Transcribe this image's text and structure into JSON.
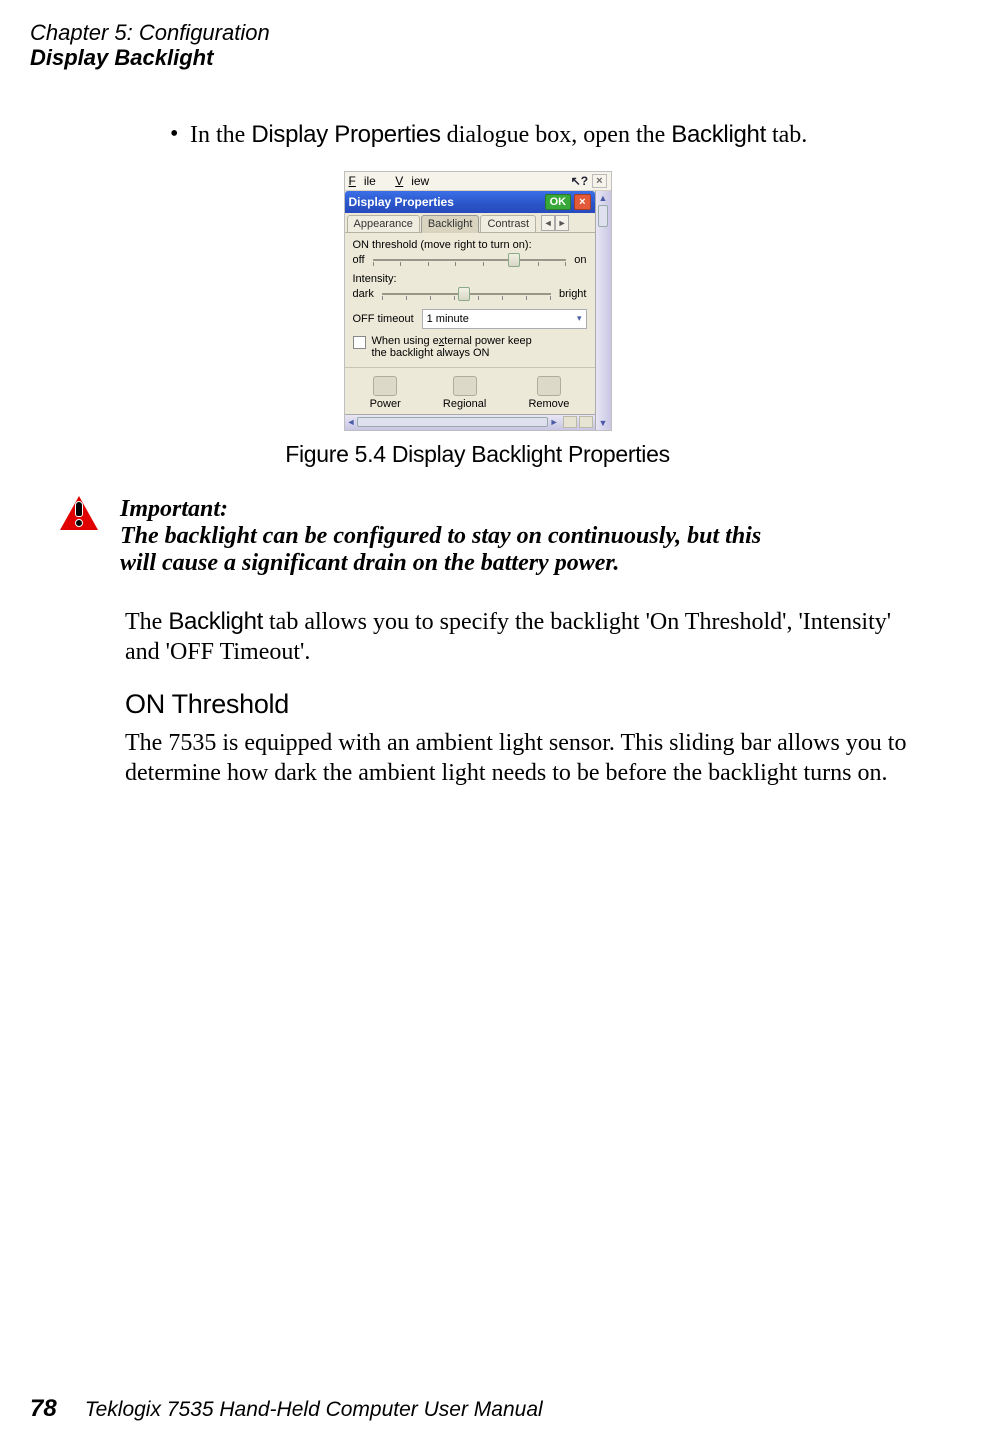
{
  "header": {
    "chapter": "Chapter 5: Configuration",
    "section": "Display Backlight"
  },
  "bullet": {
    "pre": "In the ",
    "term1": "Display Properties",
    "mid": " dialogue box, open the ",
    "term2": "Backlight",
    "post": " tab."
  },
  "figure": {
    "menubar": {
      "file": "File",
      "view": "View",
      "help": "?",
      "close": "×"
    },
    "titlebar": {
      "title": "Display Properties",
      "ok": "OK",
      "close": "×"
    },
    "tabs": {
      "appearance": "Appearance",
      "backlight": "Backlight",
      "contrast": "Contrast",
      "left": "◄",
      "right": "►"
    },
    "pane": {
      "on_label": "ON threshold (move right to turn on):",
      "off": "off",
      "on": "on",
      "intensity": "Intensity:",
      "dark": "dark",
      "bright": "bright",
      "offtimeout": "OFF timeout",
      "combo_value": "1 minute",
      "chk_line1": "When using external power keep",
      "chk_line2": "the backlight always ON"
    },
    "icons": {
      "power": "Power",
      "regional": "Regional",
      "remove": "Remove"
    },
    "hscroll": {
      "left": "◄",
      "right": "►"
    },
    "caption": "Figure 5.4 Display Backlight Properties"
  },
  "important": {
    "label": "Important:",
    "text": "The backlight can be configured to stay on continuously, but this will cause a significant drain on the battery power."
  },
  "para1": {
    "pre": "The ",
    "term": "Backlight",
    "post": " tab allows you to specify the backlight 'On Threshold', 'Intensity' and 'OFF Timeout'."
  },
  "h3": "ON Threshold",
  "para2": "The 7535 is equipped with an ambient light sensor. This sliding bar allows you to determine how dark the ambient light needs to be before the backlight turns on.",
  "footer": {
    "page": "78",
    "title": "Teklogix 7535 Hand-Held Computer User Manual"
  }
}
